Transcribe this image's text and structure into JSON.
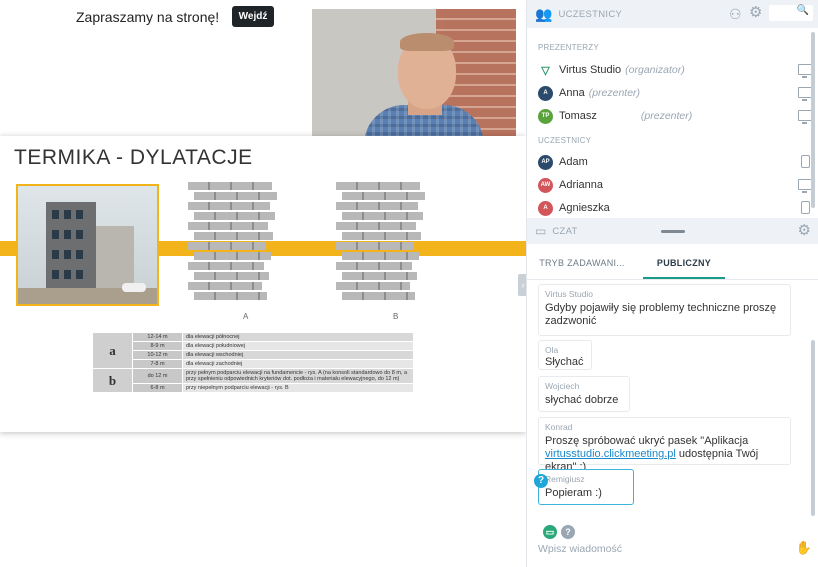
{
  "header": {
    "welcome_text": "Zapraszamy na stronę!",
    "enter_button": "Wejdź"
  },
  "slide": {
    "title": "TERMIKA - DYLATACJE",
    "wall_a_label": "A",
    "wall_b_label": "B",
    "table": [
      {
        "group": "a",
        "rows": [
          {
            "range": "12-14 m",
            "desc": "dla elewacji północnej"
          },
          {
            "range": "8-9 m",
            "desc": "dla elewacji południowej"
          },
          {
            "range": "10-12 m",
            "desc": "dla elewacji wschodniej"
          },
          {
            "range": "7-8 m",
            "desc": "dla elewacji zachodniej"
          }
        ]
      },
      {
        "group": "b",
        "rows": [
          {
            "range": "do 12 m",
            "desc": "przy pełnym podparciu elewacji na fundamencie - rys. A (na konsoli standardowo do 8 m, a przy spełnieniu odpowiednich kryteriów dot. podłoża i materiału elewacyjnego, do 12 m)"
          },
          {
            "range": "6-8 m",
            "desc": "przy niepełnym podparciu elewacji - rys. B"
          }
        ]
      }
    ]
  },
  "participants": {
    "title": "UCZESTNICY",
    "search_icon": "search-icon",
    "presenters_label": "PREZENTERZY",
    "attendees_label": "UCZESTNICY",
    "presenters": [
      {
        "initials": "",
        "name": "Virtus Studio",
        "role": "(organizator)",
        "color": "#2e9a6a",
        "device": "screen"
      },
      {
        "initials": "A",
        "name": "Anna",
        "role": "(prezenter)",
        "color": "#2c4a6b",
        "device": "screen"
      },
      {
        "initials": "TP",
        "name": "Tomasz",
        "role": "(prezenter)",
        "color": "#5aa33c",
        "device": "screen"
      }
    ],
    "attendees": [
      {
        "initials": "AP",
        "name": "Adam",
        "color": "#2c4a6b",
        "device": "phone"
      },
      {
        "initials": "AW",
        "name": "Adrianna",
        "color": "#d2555a",
        "device": "screen"
      },
      {
        "initials": "A",
        "name": "Agnieszka",
        "color": "#d2555a",
        "device": "phone"
      }
    ]
  },
  "chat": {
    "title": "CZAT",
    "tabs": [
      {
        "label": "TRYB ZADAWANI...",
        "active": false
      },
      {
        "label": "PUBLICZNY",
        "active": true
      }
    ],
    "messages": [
      {
        "author": "Virtus Studio",
        "text": "Gdyby pojawiły się problemy techniczne proszę zadzwonić"
      },
      {
        "author": "Ola",
        "text": "Słychać"
      },
      {
        "author": "Wojciech",
        "text": "słychać dobrze"
      },
      {
        "author": "Konrad",
        "text_before": "Proszę spróbować ukryć pasek \"Aplikacja ",
        "link": "virtusstudio.clickmeeting.pl",
        "text_after": " udostępnia Twój ekran\" :)"
      },
      {
        "author": "Remigiusz",
        "text": "Popieram :)"
      }
    ],
    "input_placeholder": "Wpisz wiadomość"
  }
}
